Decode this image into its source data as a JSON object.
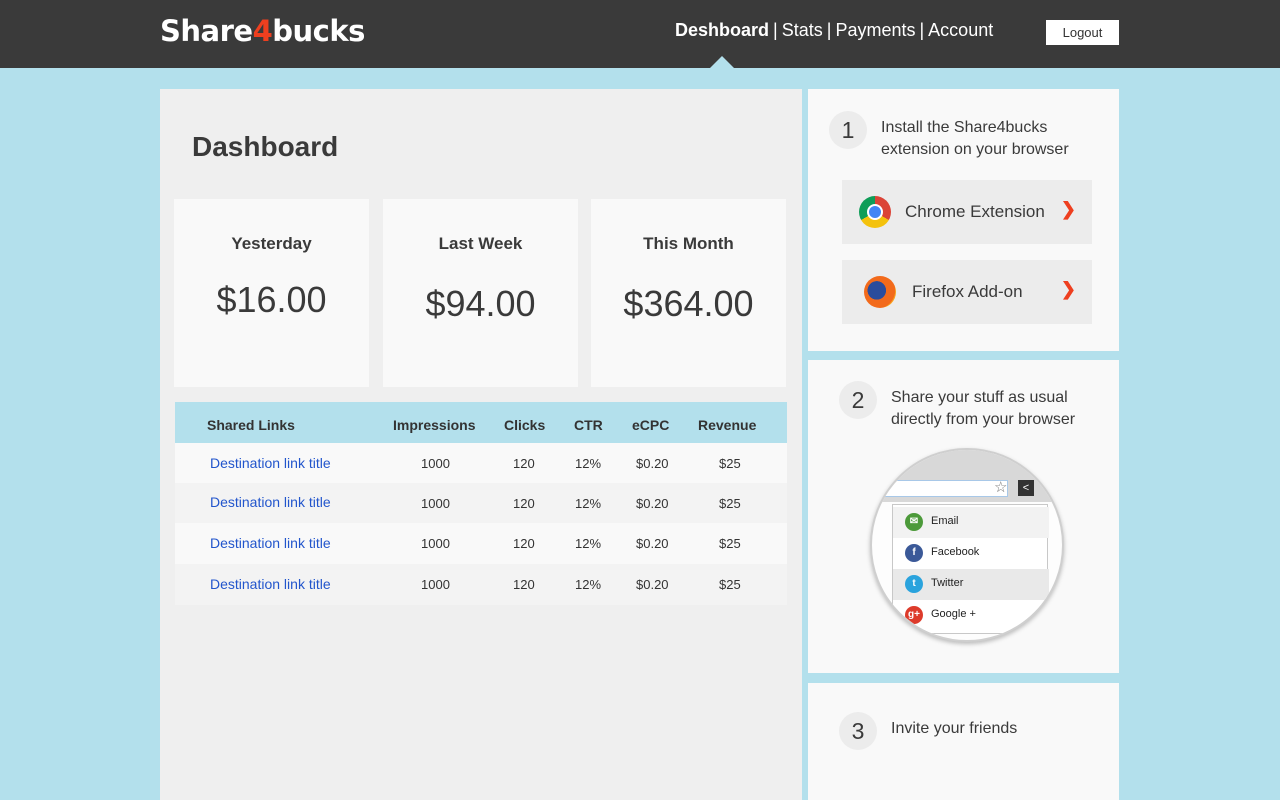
{
  "header": {
    "logo_part1": "Share",
    "logo_accent": "4",
    "logo_part2": "bucks",
    "nav": [
      "Deshboard",
      "Stats",
      "Payments",
      "Account"
    ],
    "nav_separator": "|",
    "logout_label": "Logout"
  },
  "main": {
    "title": "Dashboard",
    "cards": [
      {
        "label": "Yesterday",
        "amount": "$16.00"
      },
      {
        "label": "Last Week",
        "amount": "$94.00"
      },
      {
        "label": "This Month",
        "amount": "$364.00"
      }
    ],
    "table": {
      "headers": [
        "Shared Links",
        "Impressions",
        "Clicks",
        "CTR",
        "eCPC",
        "Revenue"
      ],
      "rows": [
        [
          "Destination link title",
          "1000",
          "120",
          "12%",
          "$0.20",
          "$25"
        ],
        [
          "Destination link title",
          "1000",
          "120",
          "12%",
          "$0.20",
          "$25"
        ],
        [
          "Destination link title",
          "1000",
          "120",
          "12%",
          "$0.20",
          "$25"
        ],
        [
          "Destination link title",
          "1000",
          "120",
          "12%",
          "$0.20",
          "$25"
        ]
      ]
    }
  },
  "steps": [
    {
      "number": "1",
      "text": "Install the Share4bucks extension on your browser",
      "buttons": [
        {
          "label": "Chrome Extension",
          "icon": "chrome-icon",
          "chevron": "❯"
        },
        {
          "label": "Firefox Add-on",
          "icon": "firefox-icon",
          "chevron": "❯"
        }
      ]
    },
    {
      "number": "2",
      "text": "Share your stuff as usual directly from your browser",
      "menu": [
        {
          "label": "Email",
          "icon": "email-icon",
          "color": "#4c9a3a"
        },
        {
          "label": "Facebook",
          "icon": "facebook-icon",
          "color": "#3b5998"
        },
        {
          "label": "Twitter",
          "icon": "twitter-icon",
          "color": "#2aa3dd"
        },
        {
          "label": "Google +",
          "icon": "google-plus-icon",
          "color": "#dd3b2b"
        }
      ]
    },
    {
      "number": "3",
      "text": "Invite your friends"
    }
  ],
  "colors": {
    "background": "#b3e0ec",
    "header": "#3a3a3a",
    "accent": "#ee3f1f",
    "link": "#2255cc"
  }
}
